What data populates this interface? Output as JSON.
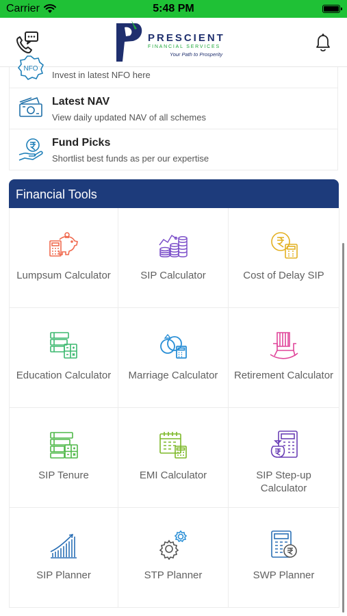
{
  "status_bar": {
    "carrier": "Carrier",
    "time": "5:48 PM"
  },
  "header": {
    "logo_title": "PRESCIENT",
    "logo_subtitle": "FINANCIAL SERVICES",
    "logo_tagline": "Your Path to Prosperity",
    "left_icon": "call-chat-icon",
    "right_icon": "bell-icon"
  },
  "menu": [
    {
      "title": "",
      "desc": "Invest in latest NFO here",
      "icon": "nfo-icon",
      "icon_label": "NFO"
    },
    {
      "title": "Latest NAV",
      "desc": "View daily updated NAV of all schemes",
      "icon": "money-icon"
    },
    {
      "title": "Fund Picks",
      "desc": "Shortlist best funds as per our expertise",
      "icon": "rupee-hand-icon"
    }
  ],
  "tools": {
    "title": "Financial Tools",
    "items": [
      {
        "label": "Lumpsum Calculator",
        "icon": "piggy-calculator-icon"
      },
      {
        "label": "SIP Calculator",
        "icon": "coins-chart-icon"
      },
      {
        "label": "Cost of Delay SIP",
        "icon": "rupee-calculator-icon"
      },
      {
        "label": "Education Calculator",
        "icon": "book-calculator-icon"
      },
      {
        "label": "Marriage Calculator",
        "icon": "rings-calculator-icon"
      },
      {
        "label": "Retirement Calculator",
        "icon": "rocking-chair-icon"
      },
      {
        "label": "SIP Tenure",
        "icon": "stack-calculator-icon"
      },
      {
        "label": "EMI Calculator",
        "icon": "calendar-calculator-icon"
      },
      {
        "label": "SIP Step-up Calculator",
        "icon": "moneybag-calculator-icon"
      },
      {
        "label": "SIP Planner",
        "icon": "growth-bars-icon"
      },
      {
        "label": "STP Planner",
        "icon": "gears-icon"
      },
      {
        "label": "SWP Planner",
        "icon": "calculator-rupee-icon"
      }
    ]
  },
  "colors": {
    "status_bar": "#1fc136",
    "tools_header": "#1d3b7b",
    "brand_navy": "#1f2f6e",
    "brand_green": "#1fa83a"
  }
}
